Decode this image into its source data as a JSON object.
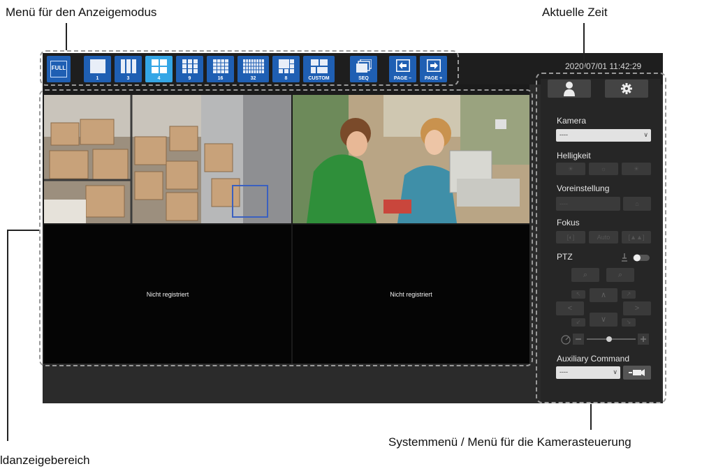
{
  "callouts": {
    "display_mode_menu": "Menü für den Anzeigemodus",
    "current_time": "Aktuelle Zeit",
    "image_display_area": "ldanzeigebereich",
    "system_menu": "Systemmenü / Menü für die Kamerasteuerung"
  },
  "toolbar": {
    "full": "FULL",
    "layouts": [
      {
        "label": "1",
        "active": false
      },
      {
        "label": "3",
        "active": false
      },
      {
        "label": "4",
        "active": true
      },
      {
        "label": "9",
        "active": false
      },
      {
        "label": "16",
        "active": false
      },
      {
        "label": "32",
        "active": false
      },
      {
        "label": "8",
        "active": false
      },
      {
        "label": "CUSTOM",
        "active": false
      }
    ],
    "seq": "SEQ",
    "page_minus": "PAGE –",
    "page_plus": "PAGE +"
  },
  "clock": "2020/07/01 11:42:29",
  "video": {
    "tiles": [
      {
        "type": "camera",
        "icon": "warehouse-camera-image"
      },
      {
        "type": "camera",
        "icon": "store-checkout-camera-image"
      },
      {
        "type": "empty",
        "message": "Nicht registriert"
      },
      {
        "type": "empty",
        "message": "Nicht registriert"
      }
    ]
  },
  "side": {
    "kamera_label": "Kamera",
    "kamera_value": "----",
    "helligkeit_label": "Helligkeit",
    "voreinstellung_label": "Voreinstellung",
    "voreinstellung_value": "----",
    "fokus_label": "Fokus",
    "fokus_auto": "Auto",
    "ptz_label": "PTZ",
    "aux_label": "Auxiliary Command",
    "aux_value": "----"
  },
  "colors": {
    "button_blue": "#1f5fb3",
    "button_active": "#34a6e6",
    "panel_dark": "#262626"
  }
}
